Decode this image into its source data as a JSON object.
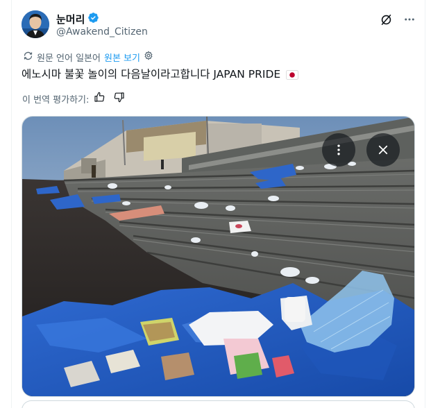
{
  "author": {
    "display_name": "눈머리",
    "handle": "@Awakend_Citizen",
    "verified_icon": "verified-badge-icon",
    "avatar_icon": "avatar-portrait"
  },
  "header_actions": {
    "grok_icon": "grok-icon",
    "more_icon": "more-horizontal-icon"
  },
  "translation": {
    "notice": "원문 언어 일본어",
    "view_original": "원본 보기",
    "settings_icon": "gear-icon"
  },
  "tweet": {
    "text": "에노시마 불꽃 놀이의 다음날이라고합니다 JAPAN PRIDE",
    "emoji": "flag-japan"
  },
  "rating": {
    "label": "이 번역 평가하기:",
    "like_icon": "thumbs-up-icon",
    "dislike_icon": "thumbs-down-icon"
  },
  "media": {
    "photo": "beach steps covered with litter and blue tarps after fireworks",
    "more_icon": "more-vertical-icon",
    "close_icon": "close-icon"
  },
  "colors": {
    "accent": "#1d9bf0",
    "secondary_text": "#536471",
    "primary_text": "#0f1419",
    "japan_red": "#bc002d"
  }
}
